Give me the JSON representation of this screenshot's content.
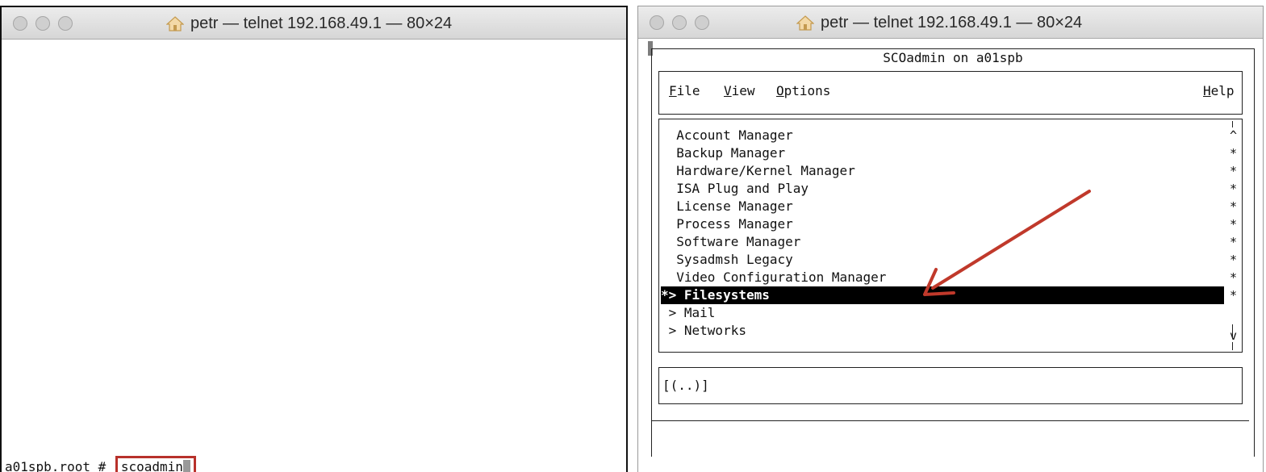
{
  "left_window": {
    "title": "petr — telnet 192.168.49.1 — 80×24",
    "prompt": "a01spb.root # ",
    "command": "scoadmin"
  },
  "right_window": {
    "title": "petr — telnet 192.168.49.1 — 80×24",
    "dialog_title": "SCOadmin on a01spb",
    "menu": {
      "file": {
        "hot": "F",
        "rest": "ile"
      },
      "view": {
        "hot": "V",
        "rest": "iew"
      },
      "options": {
        "hot": "O",
        "rest": "ptions"
      },
      "help": {
        "hot": "H",
        "rest": "elp"
      }
    },
    "list_items": [
      "  Account Manager",
      "  Backup Manager",
      "  Hardware/Kernel Manager",
      "  ISA Plug and Play",
      "  License Manager",
      "  Process Manager",
      "  Software Manager",
      "  Sysadmsh Legacy",
      "  Video Configuration Manager",
      "*> Filesystems",
      " > Mail",
      " > Networks"
    ],
    "scrollbar_marks": [
      "^",
      "*",
      "*",
      "*",
      "*",
      "*",
      "*",
      "*",
      "*",
      "*",
      "v"
    ],
    "status_text": "[(..)]"
  },
  "colors": {
    "highlight_box": "#b8312b",
    "annotation_arrow": "#c0392b",
    "selection_bg": "#000000"
  }
}
